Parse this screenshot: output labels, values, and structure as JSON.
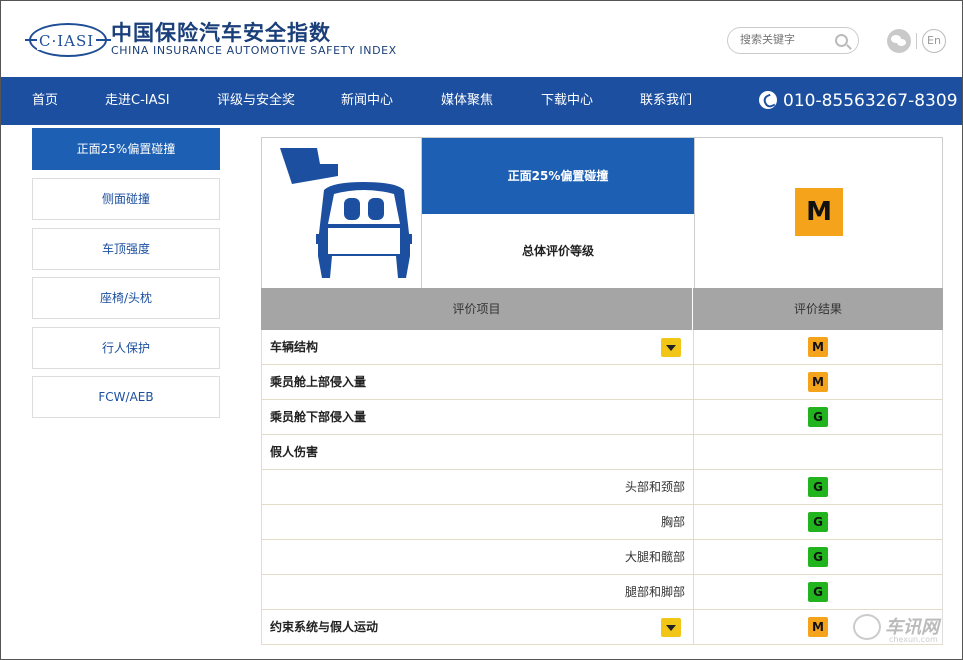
{
  "header": {
    "logo_text": "C·IASI",
    "brand_cn": "中国保险汽车安全指数",
    "brand_en": "CHINA INSURANCE AUTOMOTIVE SAFETY INDEX",
    "search_placeholder": "搜索关键字",
    "lang_label": "En"
  },
  "nav": {
    "items": [
      "首页",
      "走进C-IASI",
      "评级与安全奖",
      "新闻中心",
      "媒体聚焦",
      "下载中心",
      "联系我们"
    ],
    "phone": "010-85563267-8309"
  },
  "sidebar": {
    "items": [
      "正面25%偏置碰撞",
      "侧面碰撞",
      "车顶强度",
      "座椅/头枕",
      "行人保护",
      "FCW/AEB"
    ],
    "active_index": 0
  },
  "summary": {
    "test_name": "正面25%偏置碰撞",
    "overall_label": "总体评价等级",
    "overall_grade": "M"
  },
  "table": {
    "col_item": "评价项目",
    "col_result": "评价结果",
    "rows": [
      {
        "label": "车辆结构",
        "grade": "M",
        "expandable": true,
        "sub": false
      },
      {
        "label": "乘员舱上部侵入量",
        "grade": "M",
        "expandable": false,
        "sub": false
      },
      {
        "label": "乘员舱下部侵入量",
        "grade": "G",
        "expandable": false,
        "sub": false
      },
      {
        "label": "假人伤害",
        "grade": "",
        "expandable": false,
        "sub": false
      },
      {
        "label": "头部和颈部",
        "grade": "G",
        "expandable": false,
        "sub": true
      },
      {
        "label": "胸部",
        "grade": "G",
        "expandable": false,
        "sub": true
      },
      {
        "label": "大腿和髋部",
        "grade": "G",
        "expandable": false,
        "sub": true
      },
      {
        "label": "腿部和脚部",
        "grade": "G",
        "expandable": false,
        "sub": true
      },
      {
        "label": "约束系统与假人运动",
        "grade": "M",
        "expandable": true,
        "sub": false
      }
    ]
  },
  "colors": {
    "nav_bg": "#1c4fa0",
    "active_blue": "#1c5fb3",
    "grade_good": "#22b41f",
    "grade_marginal": "#f5a31a",
    "toggle_yellow": "#f2c616"
  },
  "watermark": {
    "text": "车讯网",
    "url": "chexun.com"
  }
}
